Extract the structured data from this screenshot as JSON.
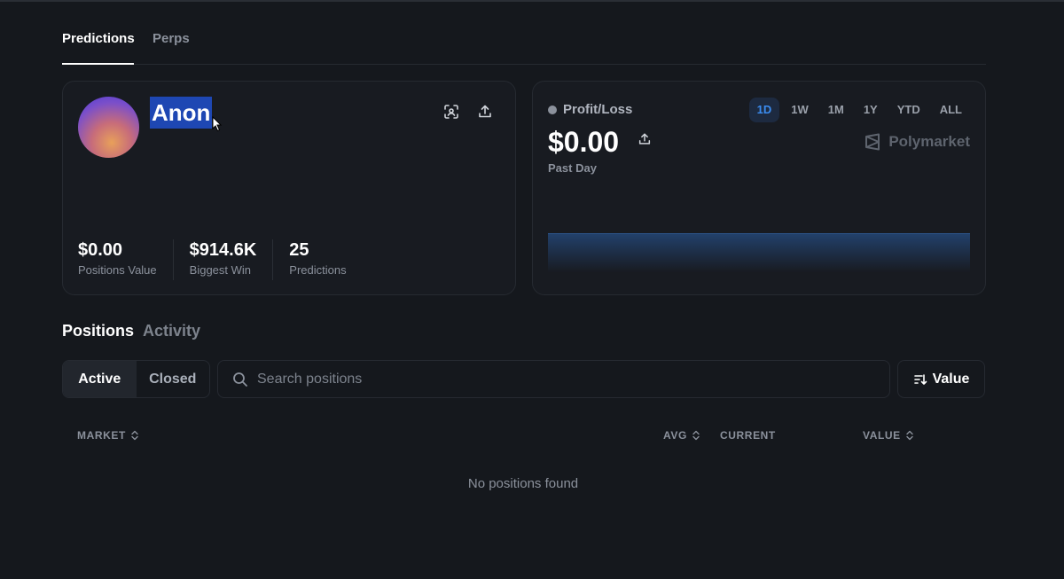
{
  "top_tabs": [
    {
      "label": "Predictions",
      "active": true
    },
    {
      "label": "Perps",
      "active": false
    }
  ],
  "profile": {
    "username": "Anon",
    "stats": [
      {
        "value": "$0.00",
        "label": "Positions Value"
      },
      {
        "value": "$914.6K",
        "label": "Biggest Win"
      },
      {
        "value": "25",
        "label": "Predictions"
      }
    ]
  },
  "pnl": {
    "label": "Profit/Loss",
    "amount": "$0.00",
    "period": "Past Day",
    "ranges": [
      "1D",
      "1W",
      "1M",
      "1Y",
      "YTD",
      "ALL"
    ],
    "active_range": "1D",
    "brand": "Polymarket"
  },
  "section_tabs": [
    {
      "label": "Positions",
      "active": true
    },
    {
      "label": "Activity",
      "active": false
    }
  ],
  "filters": {
    "segments": [
      {
        "label": "Active",
        "active": true
      },
      {
        "label": "Closed",
        "active": false
      }
    ],
    "search_placeholder": "Search positions",
    "sort_label": "Value"
  },
  "table": {
    "columns": [
      "MARKET",
      "AVG",
      "CURRENT",
      "VALUE"
    ],
    "empty_text": "No positions found"
  },
  "colors": {
    "background": "#15181d",
    "accent": "#3b8cf0",
    "selection": "#1e47b3"
  }
}
